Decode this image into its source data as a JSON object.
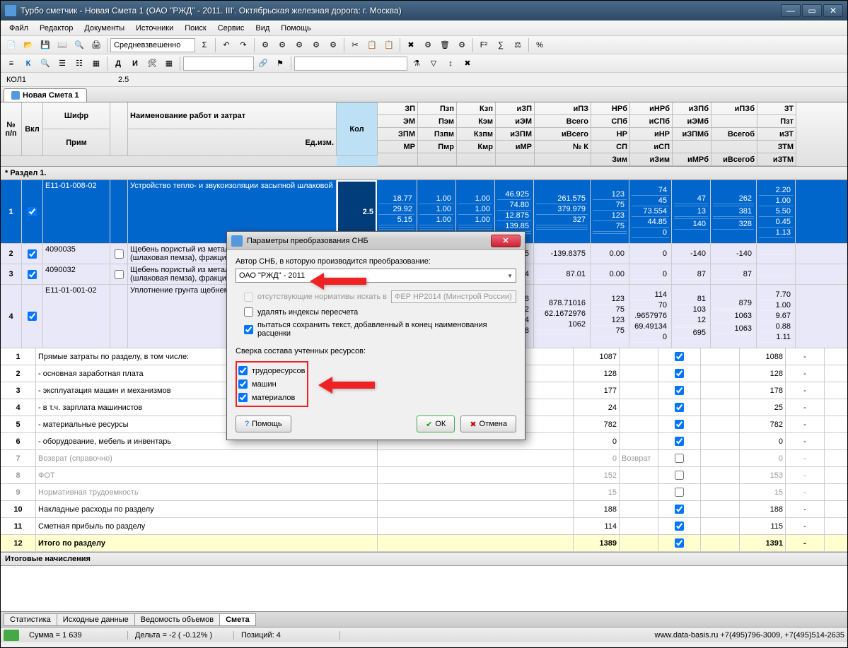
{
  "window": {
    "title": "Турбо сметчик - Новая Смета 1 (ОАО \"РЖД\" - 2011. III'. Октябрьская железная дорога: г. Москва)"
  },
  "menu": [
    "Файл",
    "Редактор",
    "Документы",
    "Источники",
    "Поиск",
    "Сервис",
    "Вид",
    "Помощь"
  ],
  "combo_weight": "Средневзвешенно",
  "formula": {
    "ref": "КОЛ1",
    "val": "2.5"
  },
  "tab": "Новая Смета 1",
  "headers": {
    "num": "№\nп/п",
    "incl": "Вкл",
    "code": "Шифр",
    "note": "Прим",
    "name": "Наименование работ и затрат",
    "unit": "Ед.изм.",
    "qty": "Кол",
    "cols": [
      "ЗП",
      "Пзп",
      "Кзп",
      "иЗП",
      "иПЗ",
      "НРб",
      "иНРб",
      "иЗПб",
      "иПЗб",
      "ЗТ"
    ],
    "cols2": [
      "ЭМ",
      "Пэм",
      "Кэм",
      "иЭМ",
      "Всего",
      "СПб",
      "иСПб",
      "иЭМб",
      "",
      "Пзт"
    ],
    "cols3": [
      "ЗПМ",
      "Пзпм",
      "Кзпм",
      "иЗПМ",
      "иВсего",
      "НР",
      "иНР",
      "иЗПМб",
      "Всегоб",
      "иЗТ"
    ],
    "cols4": [
      "МР",
      "Пмр",
      "Кмр",
      "иМР",
      "№ К",
      "СП",
      "иСП",
      "",
      "",
      "ЗТМ"
    ],
    "cols5": [
      "",
      "",
      "",
      "",
      "",
      "Зим",
      "иЗим",
      "иМРб",
      "иВсегоб",
      "иЗТМ"
    ]
  },
  "section": "* Раздел 1.",
  "rows": [
    {
      "n": "1",
      "chk": true,
      "code": "Е11-01-008-02",
      "name": "Устройство тепло- и звукоизоляции засыпной шлаковой",
      "qty": "2.5",
      "v": [
        [
          "18.77",
          "1.00",
          "1.00",
          "46.925",
          "261.575",
          "123",
          "74",
          "47",
          "262",
          "2.20"
        ],
        [
          "29.92",
          "1.00",
          "1.00",
          "74.80",
          "379.979",
          "75",
          "45",
          "",
          "",
          "1.00"
        ],
        [
          "5.15",
          "1.00",
          "1.00",
          "12.875",
          "327",
          "123",
          "73.554",
          "13",
          "381",
          "5.50"
        ],
        [
          "",
          "",
          "",
          "139.85",
          "",
          "75",
          "44.85",
          "",
          "",
          "0.45"
        ],
        [
          "",
          "",
          "",
          "",
          "",
          "",
          "0",
          "140",
          "328",
          "1.13"
        ]
      ]
    },
    {
      "n": "2",
      "chk": true,
      "code": "4090035",
      "chk2": false,
      "name": "Щебень пористый из металлургического шлака (шлаковая пемза), фракция ...",
      "v": [
        [
          "",
          "",
          "",
          "50.85",
          "-139.8375",
          "0.00",
          "0",
          "-140",
          "-140",
          ""
        ]
      ]
    },
    {
      "n": "3",
      "chk": true,
      "code": "4090032",
      "chk2": false,
      "name": "Щебень пористый из металлургического шлака (шлаковая пемза), фракция ...",
      "v": [
        [
          "",
          "",
          "",
          "31.64",
          "87.01",
          "0.00",
          "0",
          "87",
          "87",
          ""
        ]
      ]
    },
    {
      "n": "4",
      "chk": true,
      "code": "Е11-01-001-02",
      "name": "Уплотнение грунта щебнем",
      "v": [
        [
          "",
          "",
          "",
          "1.04968",
          "878.71016",
          "123",
          "114",
          "81",
          "879",
          "7.70"
        ],
        [
          "",
          "",
          "",
          "02.6152",
          "62.1672976",
          "75",
          "70",
          "103",
          "",
          "1.00"
        ],
        [
          "",
          "",
          "",
          "1.60544",
          "1062",
          "123",
          ".9657976",
          "12",
          "1063",
          "9.67"
        ],
        [
          "",
          "",
          "",
          "6.04528",
          "",
          "75",
          "69.49134",
          "",
          "",
          "0.88"
        ],
        [
          "",
          "",
          "",
          "",
          "",
          "",
          "0",
          "695",
          "1063",
          "1.11"
        ]
      ]
    }
  ],
  "calcrows": [
    {
      "n": "1",
      "name": "Прямые затраты по разделу, в том числе:",
      "v1": "1087",
      "v2": "1088",
      "dash": "-"
    },
    {
      "n": "2",
      "name": "- основная заработная плата",
      "v1": "128",
      "v2": "128",
      "dash": "-"
    },
    {
      "n": "3",
      "name": "- эксплуатация машин и механизмов",
      "v1": "177",
      "v2": "178",
      "dash": "-"
    },
    {
      "n": "4",
      "name": "  - в т.ч. зарплата машинистов",
      "v1": "24",
      "v2": "25",
      "dash": "-"
    },
    {
      "n": "5",
      "name": "- материальные ресурсы",
      "v1": "782",
      "v2": "782",
      "dash": "-"
    },
    {
      "n": "6",
      "name": "- оборудование, мебель и инвентарь",
      "v1": "0",
      "v2": "0",
      "dash": "-"
    },
    {
      "n": "7",
      "name": "Возврат (справочно)",
      "v1": "0",
      "v2txt": "Возврат",
      "v2": "0",
      "dash": "-",
      "gray": true
    },
    {
      "n": "8",
      "name": "ФОТ",
      "v1": "152",
      "v2": "153",
      "dash": "-",
      "gray": true
    },
    {
      "n": "9",
      "name": "Нормативная трудоемкость",
      "v1": "15",
      "v2": "15",
      "dash": "-",
      "gray": true
    },
    {
      "n": "10",
      "name": "Накладные расходы по разделу",
      "v1": "188",
      "v2": "188",
      "dash": "-"
    },
    {
      "n": "11",
      "name": "Сметная прибыль по разделу",
      "v1": "114",
      "v2": "115",
      "dash": "-"
    },
    {
      "n": "12",
      "name": "Итого по разделу",
      "v1": "1389",
      "v2": "1391",
      "dash": "-",
      "total": true
    }
  ],
  "final": "Итоговые начисления",
  "bottomtabs": [
    "Статистика",
    "Исходные данные",
    "Ведомость объемов",
    "Смета"
  ],
  "status": {
    "sum": "Сумма = 1 639",
    "delta": "Дельта = -2 ( -0.12% )",
    "pos": "Позиций: 4",
    "site": "www.data-basis.ru  +7(495)796-3009, +7(495)514-2635"
  },
  "dialog": {
    "title": "Параметры преобразования СНБ",
    "label_author": "Автор СНБ, в которую производится преобразование:",
    "combo_val": "ОАО \"РЖД\" - 2011",
    "opt_missing": "отсутствующие нормативы искать в",
    "opt_missing_combo": "ФЕР НР2014 (Минстрой России)",
    "opt_del_idx": "удалять индексы пересчета",
    "opt_keep_text": "пытаться сохранить текст, добавленный в конец наименования расценки",
    "label_check": "Сверка состава учтенных ресурсов:",
    "chk_labor": "трудоресурсов",
    "chk_mach": "машин",
    "chk_mat": "материалов",
    "btn_help": "Помощь",
    "btn_ok": "ОК",
    "btn_cancel": "Отмена"
  }
}
